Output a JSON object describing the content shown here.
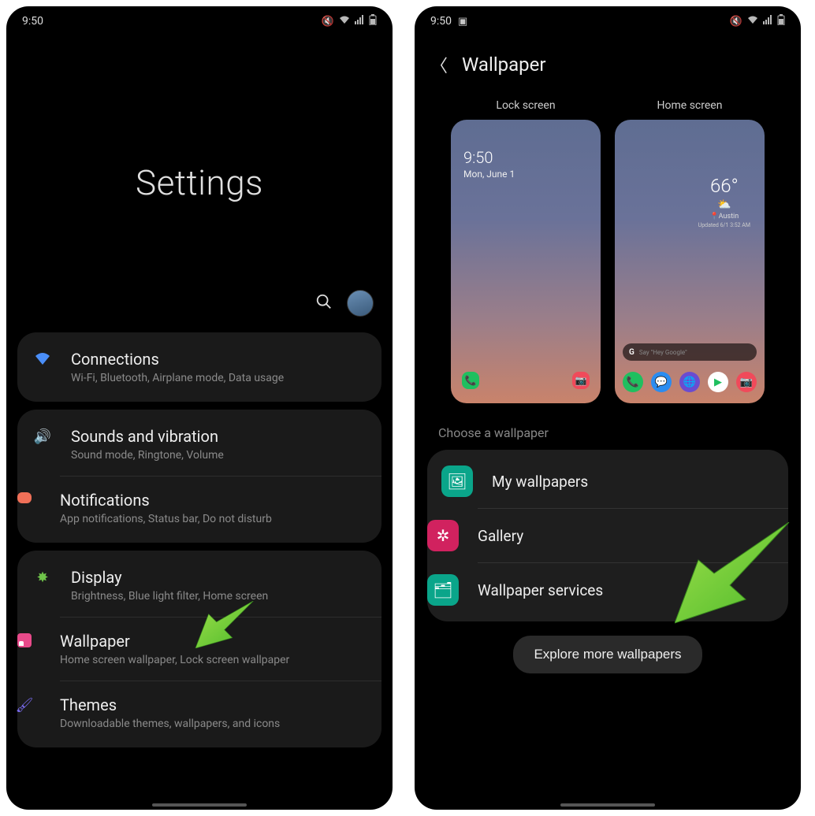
{
  "status": {
    "time": "9:50",
    "time2": "9:50"
  },
  "screen1": {
    "title": "Settings",
    "groups": [
      {
        "items": [
          {
            "title": "Connections",
            "sub": "Wi-Fi, Bluetooth, Airplane mode, Data usage",
            "icon": "wifi"
          }
        ]
      },
      {
        "items": [
          {
            "title": "Sounds and vibration",
            "sub": "Sound mode, Ringtone, Volume",
            "icon": "sound"
          },
          {
            "title": "Notifications",
            "sub": "App notifications, Status bar, Do not disturb",
            "icon": "notif"
          }
        ]
      },
      {
        "items": [
          {
            "title": "Display",
            "sub": "Brightness, Blue light filter, Home screen",
            "icon": "display"
          },
          {
            "title": "Wallpaper",
            "sub": "Home screen wallpaper, Lock screen wallpaper",
            "icon": "wallpaper"
          },
          {
            "title": "Themes",
            "sub": "Downloadable themes, wallpapers, and icons",
            "icon": "themes"
          }
        ]
      }
    ]
  },
  "screen2": {
    "title": "Wallpaper",
    "previews": {
      "lock": {
        "label": "Lock screen",
        "time": "9:50",
        "date": "Mon, June 1"
      },
      "home": {
        "label": "Home screen",
        "temp": "66°",
        "city": "Austin",
        "updated": "Updated 6/1 3:52 AM",
        "search_hint": "Say \"Hey Google\""
      }
    },
    "section_label": "Choose a wallpaper",
    "choices": [
      {
        "label": "My wallpapers",
        "icon": "mywp"
      },
      {
        "label": "Gallery",
        "icon": "gallery"
      },
      {
        "label": "Wallpaper services",
        "icon": "services"
      }
    ],
    "explore": "Explore more wallpapers"
  }
}
